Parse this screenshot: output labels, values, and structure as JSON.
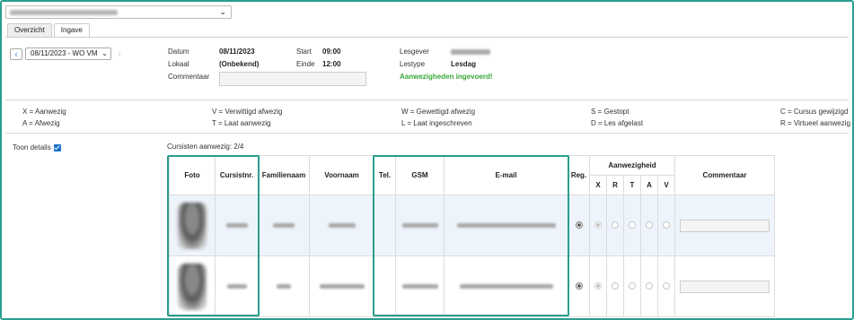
{
  "tabs": [
    {
      "label": "Overzicht",
      "active": false
    },
    {
      "label": "Ingave",
      "active": true
    }
  ],
  "date_select": {
    "value": "08/11/2023 - WO VM"
  },
  "session": {
    "datum_label": "Datum",
    "datum_value": "08/11/2023",
    "lokaal_label": "Lokaal",
    "lokaal_value": "(Onbekend)",
    "commentaar_label": "Commentaar",
    "start_label": "Start",
    "start_value": "09:00",
    "einde_label": "Einde",
    "einde_value": "12:00",
    "lesgever_label": "Lesgever",
    "lestype_label": "Lestype",
    "lestype_value": "Lesdag",
    "status": "Aanwezigheden ingevoerd!"
  },
  "legend": [
    [
      "X = Aanwezig",
      "V = Verwittigd afwezig",
      "W = Gewettigd afwezig",
      "S = Gestopt",
      "C = Cursus gewijzigd"
    ],
    [
      "A = Afwezig",
      "T = Laat aanwezig",
      "L = Laat ingeschreven",
      "D = Les afgelast",
      "R = Virtueel aanwezig"
    ]
  ],
  "toon_details": {
    "label": "Toon details",
    "checked": true
  },
  "count_text": "Cursisten aanwezig: 2/4",
  "table": {
    "headers": {
      "foto": "Foto",
      "cursistnr": "Cursistnr.",
      "familienaam": "Familienaam",
      "voornaam": "Voornaam",
      "tel": "Tel.",
      "gsm": "GSM",
      "email": "E-mail",
      "reg": "Reg.",
      "aanwezigheid": "Aanwezigheid",
      "commentaar": "Commentaar"
    },
    "codes": [
      "X",
      "R",
      "T",
      "A",
      "V"
    ]
  },
  "colors": {
    "highlight": "#2a9d8f",
    "status_green": "#3aa83a",
    "link_blue": "#1a73c9"
  }
}
